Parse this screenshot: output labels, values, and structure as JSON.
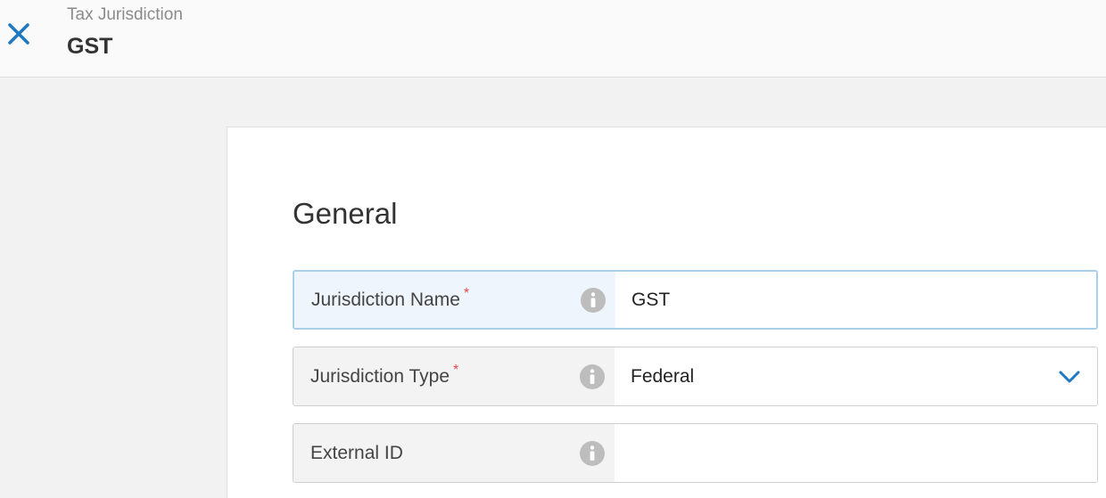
{
  "header": {
    "breadcrumb": "Tax Jurisdiction",
    "title": "GST",
    "close_icon": "close-icon",
    "accent_color": "#1f79c2"
  },
  "section": {
    "title": "General"
  },
  "fields": [
    {
      "label": "Jurisdiction Name",
      "required": true,
      "required_mark": "*",
      "value": "GST",
      "type": "text",
      "focused": true,
      "icon": "info-icon"
    },
    {
      "label": "Jurisdiction Type",
      "required": true,
      "required_mark": "*",
      "value": "Federal",
      "type": "select",
      "icon": "info-icon",
      "dropdown_icon": "chevron-down-icon"
    },
    {
      "label": "External ID",
      "required": false,
      "value": "",
      "type": "text",
      "icon": "info-icon"
    }
  ]
}
